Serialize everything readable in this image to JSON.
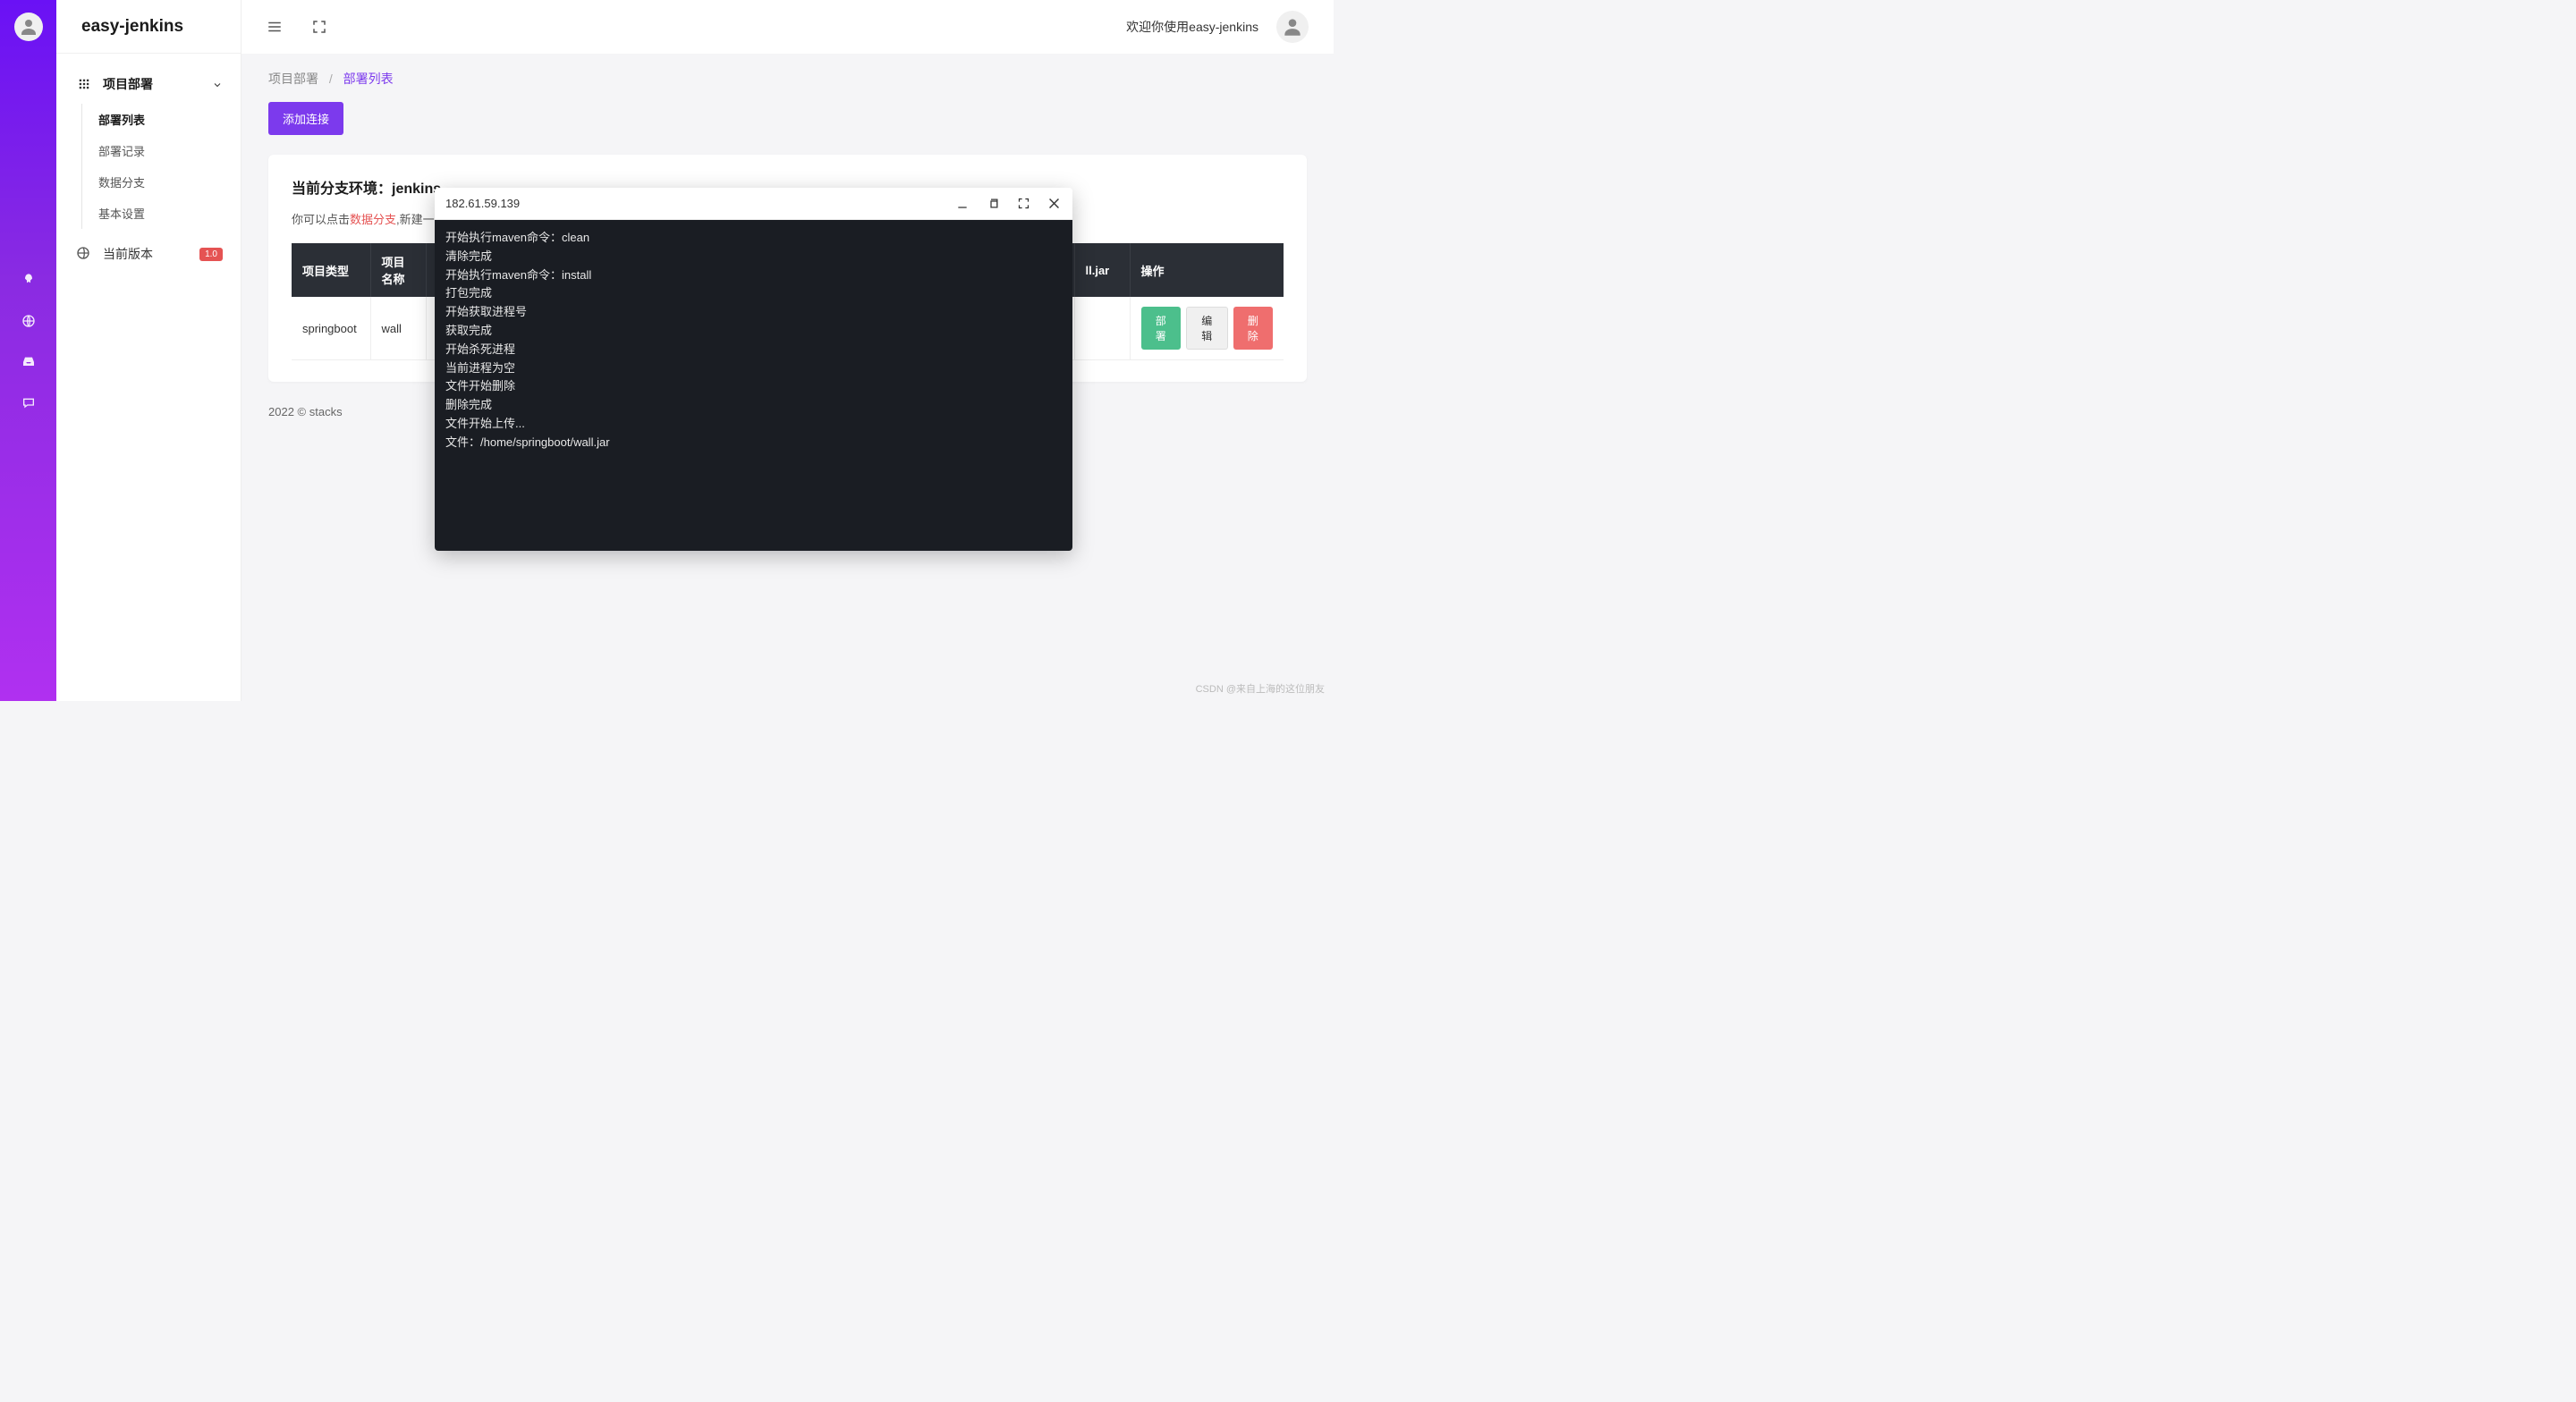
{
  "app": {
    "name": "easy-jenkins"
  },
  "topbar": {
    "welcome": "欢迎你使用easy-jenkins"
  },
  "sidebar": {
    "parent": "项目部署",
    "children": [
      {
        "label": "部署列表",
        "active": true
      },
      {
        "label": "部署记录",
        "active": false
      },
      {
        "label": "数据分支",
        "active": false
      },
      {
        "label": "基本设置",
        "active": false
      }
    ],
    "version": {
      "label": "当前版本",
      "badge": "1.0"
    }
  },
  "breadcrumb": {
    "root": "项目部署",
    "current": "部署列表"
  },
  "buttons": {
    "add": "添加连接"
  },
  "card": {
    "title": "当前分支环境：jenkins",
    "hint_prefix": "你可以点击",
    "hint_link": "数据分支",
    "hint_suffix": ",新建一"
  },
  "table": {
    "headers": {
      "type": "项目类型",
      "name": "项目名称",
      "file": "ll.jar",
      "actions": "操作"
    },
    "row": {
      "type": "springboot",
      "name": "wall",
      "file": ""
    },
    "actions": {
      "deploy": "部署",
      "edit": "编辑",
      "delete": "删除"
    }
  },
  "footer": "2022 © stacks",
  "terminal": {
    "title": "182.61.59.139",
    "lines": [
      "开始执行maven命令：clean",
      "清除完成",
      "开始执行maven命令：install",
      "打包完成",
      "开始获取进程号",
      "获取完成",
      "开始杀死进程",
      "当前进程为空",
      "文件开始删除",
      "删除完成",
      "文件开始上传...",
      "文件：/home/springboot/wall.jar"
    ]
  },
  "watermark": "CSDN @来自上海的这位朋友"
}
